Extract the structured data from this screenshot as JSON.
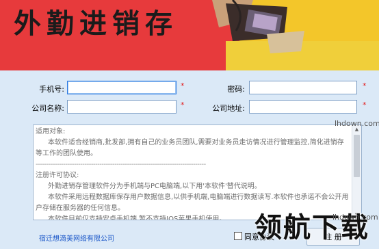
{
  "banner": {
    "title": "外勤进销存"
  },
  "form": {
    "phone_label": "手机号:",
    "password_label": "密码:",
    "company_label": "公司名称:",
    "address_label": "公司地址:",
    "required_mark": "*",
    "phone_value": "",
    "password_value": "",
    "company_value": "",
    "address_value": ""
  },
  "agreement": {
    "heading1": "适用对象:",
    "para1": "本软件适合经销商,批发部,拥有自己的业务员团队,需要对业务员走访情况进行管理监控,简化进销存等工作的团队使用。",
    "divider": "--------------------------------------------------------------------------------",
    "heading2": "注册许可协议:",
    "para2": "外勤进销存管理软件分为手机端与PC电脑端,以下用'本软件'替代说明。",
    "para3": "本软件采用远程数据库保存用户数据信息,以供手机端,电脑端进行数据读写.本软件也承诺不会公开用户存储在服务器的任何信息。",
    "para4": "本软件目前仅支持安卓手机端,暂不支持IOS苹果手机使用。"
  },
  "footer": {
    "company": "宿迁想滴美网络有限公司",
    "agree_label": "同意协议",
    "register_label": "注 册"
  },
  "watermark": {
    "text": "领航下载",
    "url": "lhdown.com"
  },
  "colors": {
    "banner_red": "#e73a3c",
    "banner_yellow": "#f3c62a",
    "form_bg": "#dbe9f7",
    "required": "#e21b1b",
    "link": "#1a56c8"
  }
}
